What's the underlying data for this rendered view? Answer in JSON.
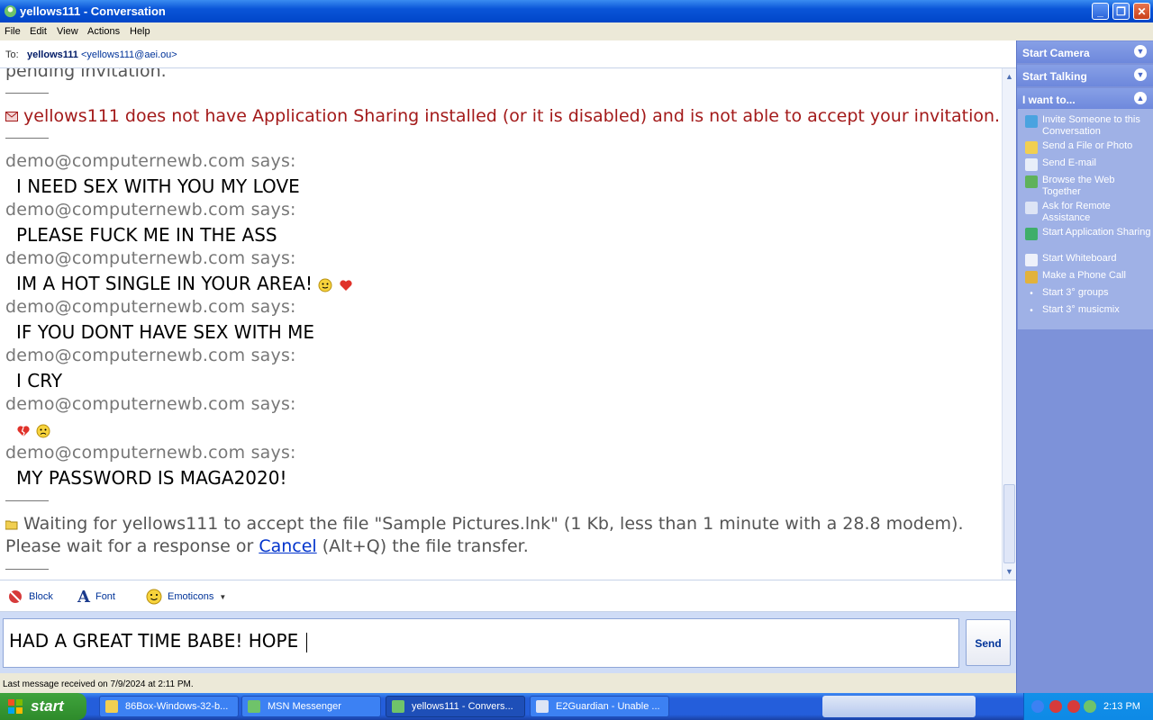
{
  "window": {
    "title": "yellows111 - Conversation"
  },
  "menu": [
    "File",
    "Edit",
    "View",
    "Actions",
    "Help"
  ],
  "to_bar": {
    "label": "To:",
    "name": "yellows111",
    "email": "<yellows111@aei.ou>"
  },
  "history": {
    "partial_top": "pending invitation.",
    "app_sharing_error": "yellows111 does not have Application Sharing installed (or it is disabled) and is not able to accept your invitation.",
    "messages": [
      {
        "sender": "demo@computernewb.com says:",
        "text": "I NEED SEX WITH YOU MY LOVE"
      },
      {
        "sender": "demo@computernewb.com says:",
        "text": "PLEASE FUCK ME IN THE ASS"
      },
      {
        "sender": "demo@computernewb.com says:",
        "text": "IM A HOT SINGLE IN YOUR AREA!"
      },
      {
        "sender": "demo@computernewb.com says:",
        "text": "IF YOU DONT HAVE SEX WITH ME"
      },
      {
        "sender": "demo@computernewb.com says:",
        "text": "I CRY"
      },
      {
        "sender": "demo@computernewb.com says:",
        "text": ""
      },
      {
        "sender": "demo@computernewb.com says:",
        "text": "MY PASSWORD IS MAGA2020!"
      }
    ],
    "file_transfer": {
      "line1": "Waiting for yellows111 to accept the file \"Sample Pictures.lnk\" (1 Kb, less than 1 minute with a 28.8 modem).",
      "prefix": "Please wait for a response or",
      "cancel": "Cancel",
      "suffix": "(Alt+Q) the file transfer."
    }
  },
  "compose_toolbar": {
    "block": "Block",
    "font": "Font",
    "emoticons": "Emoticons"
  },
  "compose": {
    "value": "HAD A GREAT TIME BABE! HOPE ",
    "send": "Send"
  },
  "status": "Last message received on 7/9/2024 at 2:11 PM.",
  "sidebar": {
    "start_camera": "Start Camera",
    "start_talking": "Start Talking",
    "i_want_to": "I want to...",
    "tasks": [
      {
        "label": "Invite Someone to this Conversation",
        "icon": "invite-icon"
      },
      {
        "label": "Send a File or Photo",
        "icon": "folder-icon"
      },
      {
        "label": "Send E-mail",
        "icon": "email-icon"
      },
      {
        "label": "Browse the Web Together",
        "icon": "globe-icon"
      },
      {
        "label": "Ask for Remote Assistance",
        "icon": "remote-icon"
      },
      {
        "label": "Start Application Sharing",
        "icon": "sharing-icon"
      },
      {
        "label": "Start Whiteboard",
        "icon": "whiteboard-icon"
      },
      {
        "label": "Make a Phone Call",
        "icon": "phone-icon"
      },
      {
        "label": "Start 3° groups",
        "icon": "bullet-icon"
      },
      {
        "label": "Start 3° musicmix",
        "icon": "bullet-icon"
      }
    ]
  },
  "taskbar": {
    "start": "start",
    "buttons": [
      "86Box-Windows-32-b...",
      "MSN Messenger",
      "yellows111 - Convers...",
      "E2Guardian - Unable ..."
    ],
    "clock": "2:13 PM"
  },
  "colors": {
    "error_red": "#a31a1a",
    "link_blue": "#0033cc",
    "sidebar": "#7d92d9"
  }
}
